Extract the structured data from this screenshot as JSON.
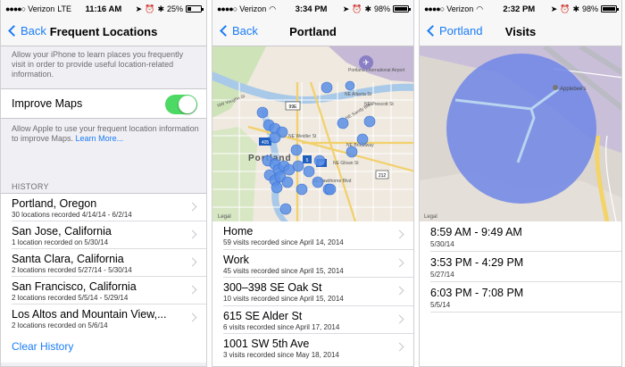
{
  "colors": {
    "accent": "#1a7cf5",
    "toggle_on": "#4cd964",
    "pin": "#5b8fe6",
    "visit_circle": "#6f86e6"
  },
  "screen1": {
    "status": {
      "carrier": "Verizon",
      "network": "LTE",
      "time": "11:16 AM",
      "battery": "25%",
      "battery_level": 0.25
    },
    "nav": {
      "back": "Back",
      "title": "Frequent Locations"
    },
    "intro_note": "Allow your iPhone to learn places you frequently visit in order to provide useful location-related information.",
    "improve_maps": {
      "label": "Improve Maps",
      "on": true
    },
    "improve_note": "Allow Apple to use your frequent location information to improve Maps.",
    "learn_more": "Learn More...",
    "history_header": "HISTORY",
    "history": [
      {
        "title": "Portland, Oregon",
        "subtitle": "30 locations recorded 4/14/14 - 6/2/14"
      },
      {
        "title": "San Jose, California",
        "subtitle": "1 location recorded on 5/30/14"
      },
      {
        "title": "Santa Clara, California",
        "subtitle": "2 locations recorded 5/27/14 - 5/30/14"
      },
      {
        "title": "San Francisco, California",
        "subtitle": "2 locations recorded 5/5/14 - 5/29/14"
      },
      {
        "title": "Los Altos and Mountain View,...",
        "subtitle": "2 locations recorded on 5/6/14"
      }
    ],
    "clear_history": "Clear History"
  },
  "screen2": {
    "status": {
      "carrier": "Verizon",
      "time": "3:34 PM",
      "battery": "98%",
      "battery_level": 0.98
    },
    "nav": {
      "back": "Back",
      "title": "Portland"
    },
    "map": {
      "city_label": "Portland",
      "airport_label": "Portland International Airport",
      "streets": [
        "NW Vaughn St",
        "NE Alberta St",
        "NE Weidler St",
        "NE Broadway",
        "NE Glisan St",
        "SE Hawthorne Blvd",
        "NE Sandy Blvd",
        "NE Prescott St"
      ],
      "shields": [
        "99E",
        "405",
        "5",
        "84",
        "212"
      ],
      "legal": "Legal"
    },
    "places": [
      {
        "title": "Home",
        "subtitle": "59 visits recorded since April 14, 2014"
      },
      {
        "title": "Work",
        "subtitle": "45 visits recorded since April 15, 2014"
      },
      {
        "title": "300–398 SE Oak St",
        "subtitle": "10 visits recorded since April 15, 2014"
      },
      {
        "title": "615 SE Alder St",
        "subtitle": "6 visits recorded since April 17, 2014"
      },
      {
        "title": "1001 SW 5th Ave",
        "subtitle": "3 visits recorded since May 18, 2014"
      }
    ]
  },
  "screen3": {
    "status": {
      "carrier": "Verizon",
      "time": "2:32 PM",
      "battery": "98%",
      "battery_level": 0.98
    },
    "nav": {
      "back": "Portland",
      "title": "Visits"
    },
    "map": {
      "poi_label": "Applebee's",
      "legal": "Legal"
    },
    "visits": [
      {
        "time": "8:59 AM - 9:49 AM",
        "date": "5/30/14"
      },
      {
        "time": "3:53 PM - 4:29 PM",
        "date": "5/27/14"
      },
      {
        "time": "6:03 PM - 7:08 PM",
        "date": "5/5/14"
      }
    ]
  }
}
